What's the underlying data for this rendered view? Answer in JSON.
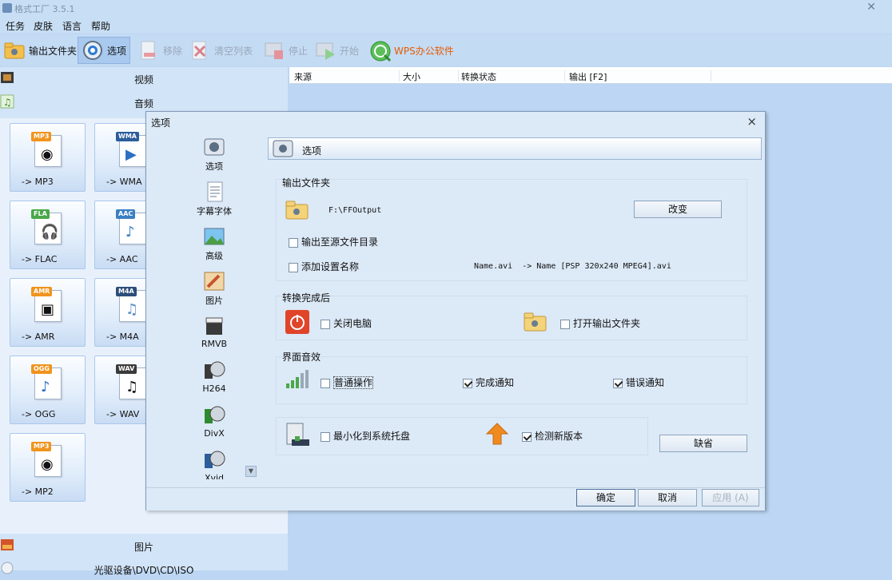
{
  "window": {
    "title": "格式工厂 3.5.1"
  },
  "menu": [
    "任务",
    "皮肤",
    "语言",
    "帮助"
  ],
  "toolbar": {
    "output_folder": "输出文件夹",
    "options": "选项",
    "remove": "移除",
    "clear_list": "清空列表",
    "stop": "停止",
    "start": "开始",
    "wps": "WPS办公软件",
    "wps_color": "#e65c00"
  },
  "leftpane": {
    "video": "视频",
    "audio": "音频",
    "picture": "图片",
    "device": "光驱设备\\DVD\\CD\\ISO",
    "tiles": [
      {
        "badge": "MP3",
        "label": "-> MP3",
        "color": "#f0941d"
      },
      {
        "badge": "WMA",
        "label": "-> WMA",
        "color": "#2c5d9b"
      },
      {
        "badge": "FLA",
        "label": "-> FLAC",
        "color": "#4aa84a"
      },
      {
        "badge": "AAC",
        "label": "-> AAC",
        "color": "#3b7fc4"
      },
      {
        "badge": "AMR",
        "label": "-> AMR",
        "color": "#f0941d"
      },
      {
        "badge": "M4A",
        "label": "-> M4A",
        "color": "#2c4e7a"
      },
      {
        "badge": "OGG",
        "label": "-> OGG",
        "color": "#f0941d"
      },
      {
        "badge": "WAV",
        "label": "-> WAV",
        "color": "#3a3a3a"
      },
      {
        "badge": "MP3",
        "label": "-> MP2",
        "color": "#f0941d"
      }
    ]
  },
  "table": {
    "columns": [
      "来源",
      "大小",
      "转换状态",
      "输出 [F2]"
    ]
  },
  "dialog": {
    "title": "选项",
    "sidebar": [
      "选项",
      "字幕字体",
      "高级",
      "图片",
      "RMVB",
      "H264",
      "DivX",
      "Xvid"
    ],
    "header": "选项",
    "output_section": {
      "title": "输出文件夹",
      "path": "F:\\FFOutput",
      "change_button": "改变",
      "output_to_source": "输出至源文件目录",
      "add_setting_name": "添加设置名称",
      "name_example": "Name.avi  -> Name [PSP 320x240 MPEG4].avi"
    },
    "after_section": {
      "title": "转换完成后",
      "shutdown": "关闭电脑",
      "open_output": "打开输出文件夹"
    },
    "sound_section": {
      "title": "界面音效",
      "normal_op": "普通操作",
      "complete_notify": "完成通知",
      "error_notify": "错误通知"
    },
    "misc": {
      "minimize_tray": "最小化到系统托盘",
      "check_update": "检测新版本",
      "default_button": "缺省"
    },
    "buttons": {
      "ok": "确定",
      "cancel": "取消",
      "apply": "应用 (A)"
    }
  }
}
